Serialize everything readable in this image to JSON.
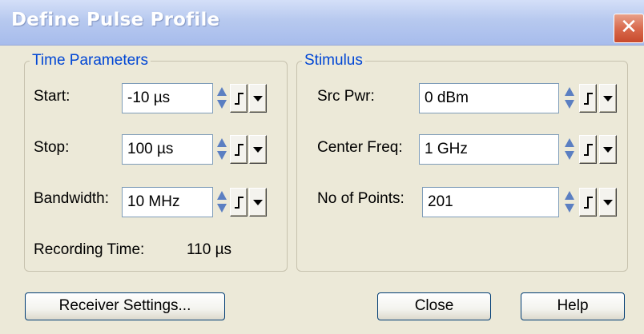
{
  "dialog": {
    "title": "Define Pulse Profile"
  },
  "time_parameters": {
    "legend": "Time Parameters",
    "start": {
      "label": "Start:",
      "value": "-10 µs"
    },
    "stop": {
      "label": "Stop:",
      "value": "100 µs"
    },
    "bandwidth": {
      "label": "Bandwidth:",
      "value": "10 MHz"
    },
    "recording_time": {
      "label": "Recording Time:",
      "value": "110 µs"
    }
  },
  "stimulus": {
    "legend": "Stimulus",
    "src_pwr": {
      "label": "Src Pwr:",
      "value": "0 dBm"
    },
    "center_freq": {
      "label": "Center Freq:",
      "value": "1 GHz"
    },
    "points": {
      "label": "No of Points:",
      "value": "201"
    }
  },
  "buttons": {
    "receiver_settings": "Receiver Settings...",
    "close": "Close",
    "help": "Help"
  },
  "icons": {
    "close": "close-icon",
    "spin_up": "spin-up-icon",
    "spin_down": "spin-down-icon",
    "step": "step-icon",
    "dropdown": "dropdown-arrow-icon"
  },
  "colors": {
    "dialog_bg": "#ECE9D8",
    "titlebar": "#B7C9EF",
    "legend_text": "#0046D5",
    "close_button": "#D96B4E",
    "button_border": "#003C74"
  }
}
